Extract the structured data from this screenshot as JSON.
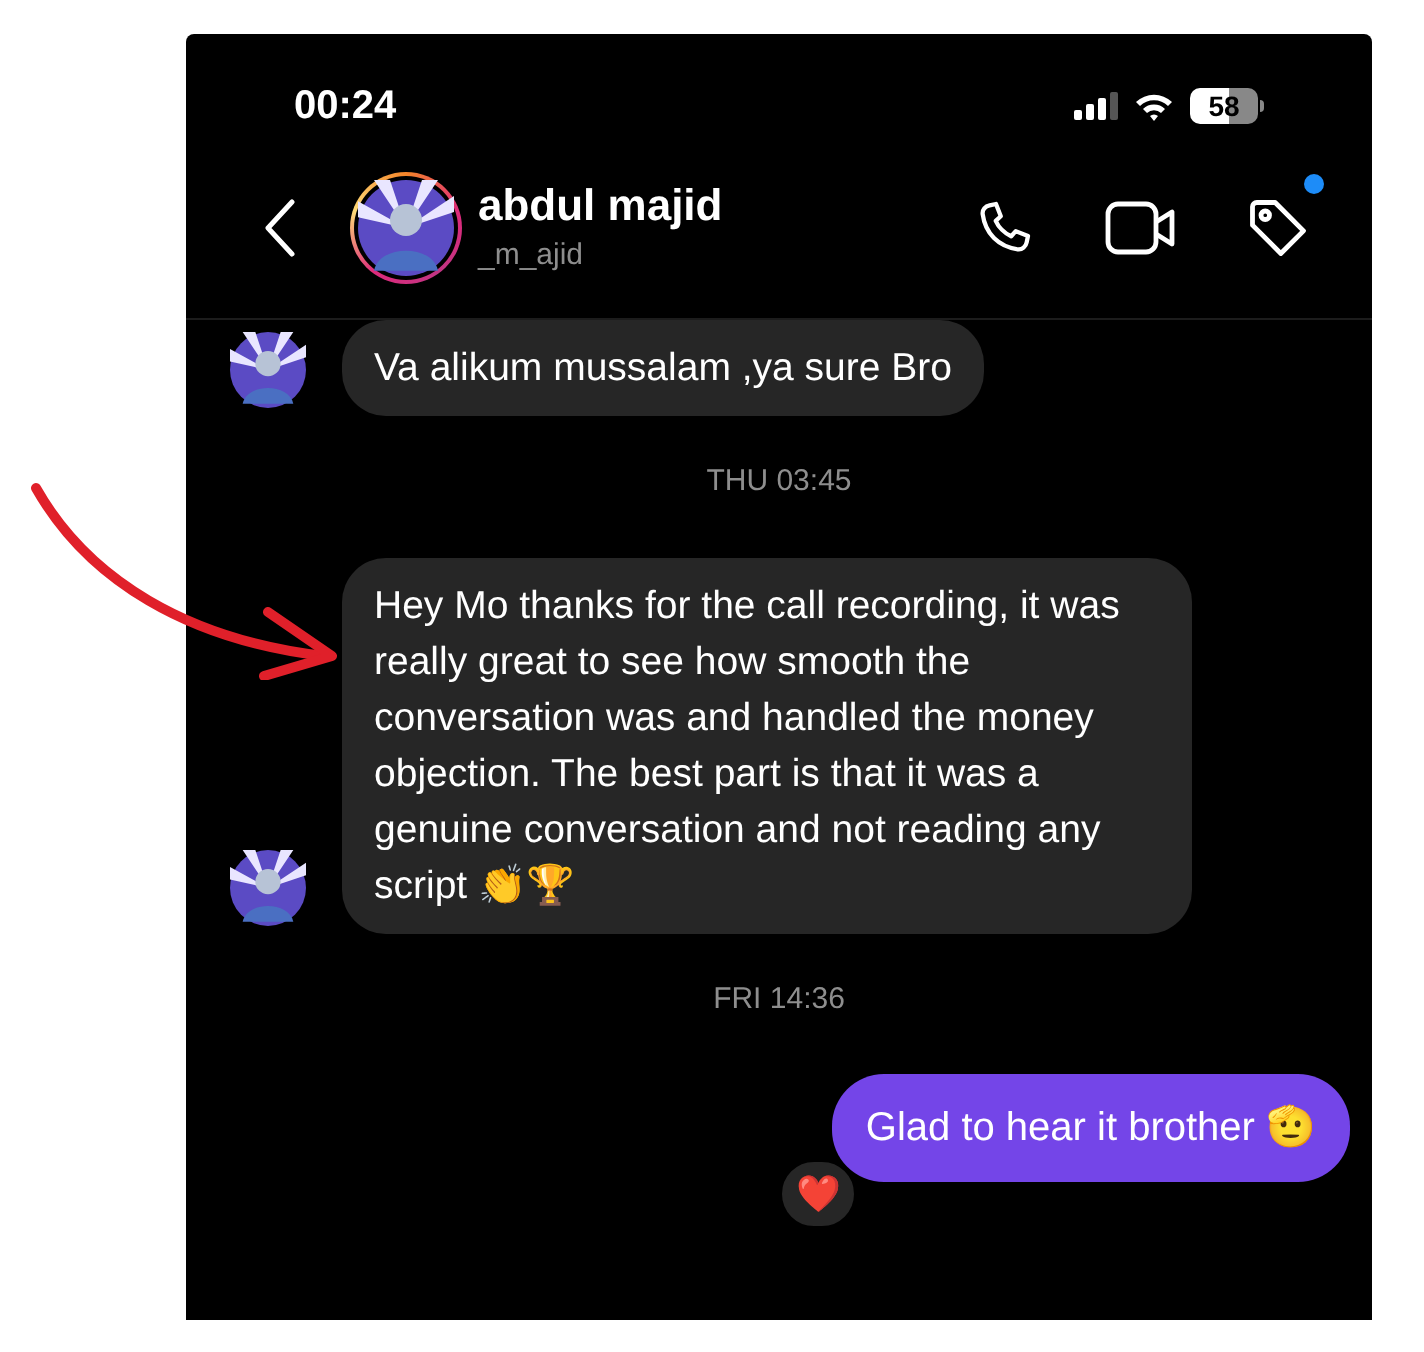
{
  "status_bar": {
    "time": "00:24",
    "battery": "58"
  },
  "header": {
    "name": "abdul majid",
    "username": "_m_ajid",
    "tag_badge": true
  },
  "messages": [
    {
      "kind": "received",
      "text": "Va alikum mussalam ,ya sure Bro",
      "avatar": true
    },
    {
      "kind": "timestamp",
      "text": "THU 03:45"
    },
    {
      "kind": "received",
      "text": "Hey Mo thanks for the call recording, it was really great to see how smooth the conversation was and handled the money objection. The best part is that it was a genuine conversation and not reading any script 👏🏆",
      "avatar": true
    },
    {
      "kind": "timestamp",
      "text": "FRI 14:36"
    },
    {
      "kind": "sent",
      "text": "Glad to hear it brother 🫡",
      "reaction": "❤️"
    }
  ]
}
